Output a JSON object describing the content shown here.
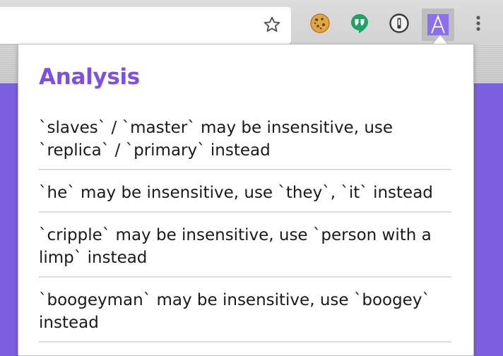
{
  "toolbar": {
    "bookmark_icon": "star-icon",
    "extensions": [
      {
        "name": "cookie-icon"
      },
      {
        "name": "hangouts-icon"
      },
      {
        "name": "1password-icon"
      },
      {
        "name": "alex-icon",
        "letter": "A"
      }
    ],
    "menu_icon": "more-vert-icon"
  },
  "popup": {
    "title": "Analysis",
    "title_color": "#7c4fe8",
    "items": [
      "`slaves` / `master` may be insensitive, use `replica` / `primary` instead",
      "`he` may be insensitive, use `they`, `it` instead",
      "`cripple` may be insensitive, use `person with a limp` instead",
      "`boogeyman` may be insensitive, use `boogey` instead"
    ]
  },
  "colors": {
    "page_background": "#7b5fe0",
    "accent": "#8a6ff0"
  }
}
